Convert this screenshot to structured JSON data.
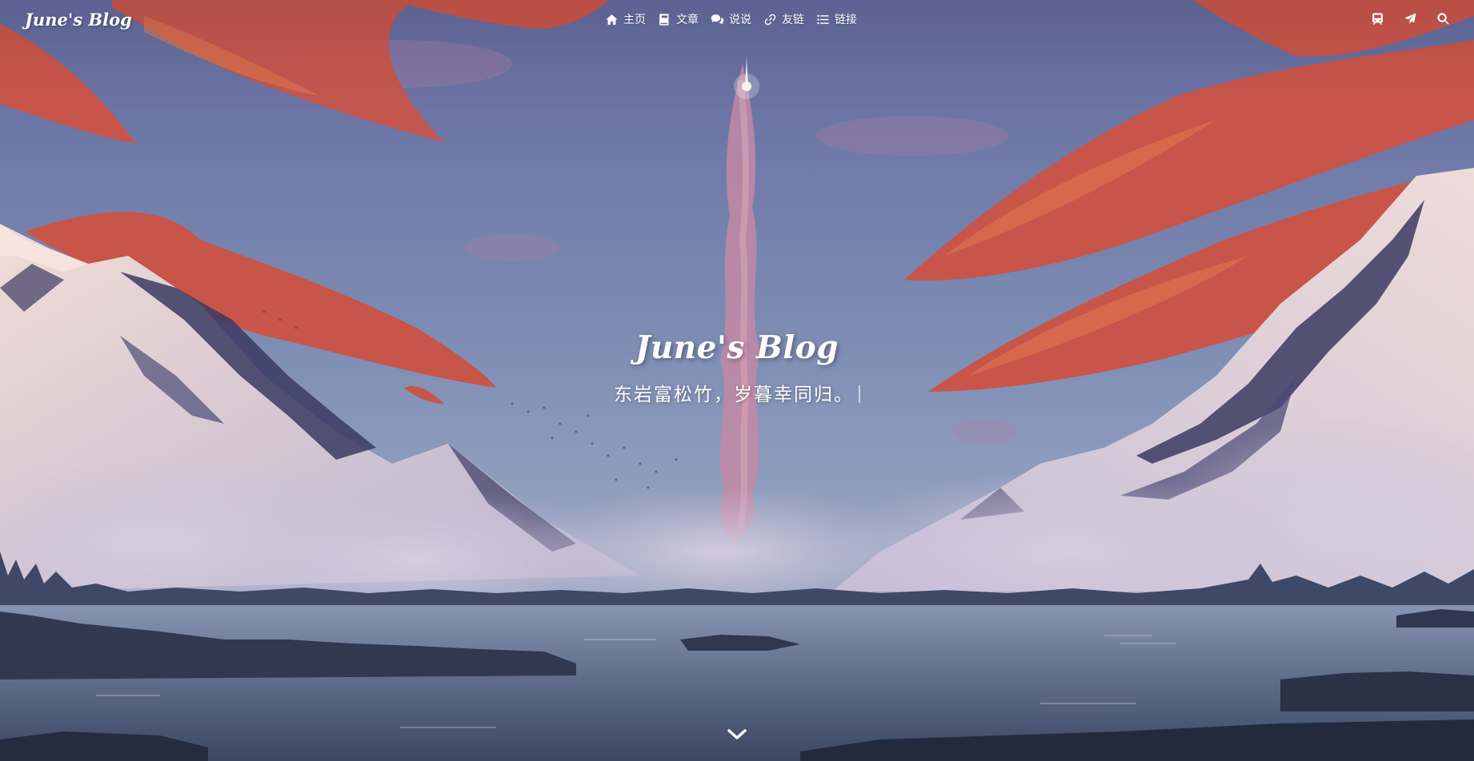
{
  "nav": {
    "brand": "June's Blog",
    "menu": [
      {
        "label": "主页",
        "icon": "home-icon"
      },
      {
        "label": "文章",
        "icon": "book-icon"
      },
      {
        "label": "说说",
        "icon": "comments-icon"
      },
      {
        "label": "友链",
        "icon": "link-icon"
      },
      {
        "label": "链接",
        "icon": "list-icon"
      }
    ],
    "right_icons": [
      "train-icon",
      "paper-plane-icon",
      "search-icon"
    ]
  },
  "hero": {
    "title": "June's Blog",
    "subtitle": "东岩富松竹，岁暮幸同归。"
  },
  "colors": {
    "sky": "#6c75a6",
    "cloud": "#c8554a",
    "snow": "#e3d2dc",
    "water": "#51607f"
  }
}
